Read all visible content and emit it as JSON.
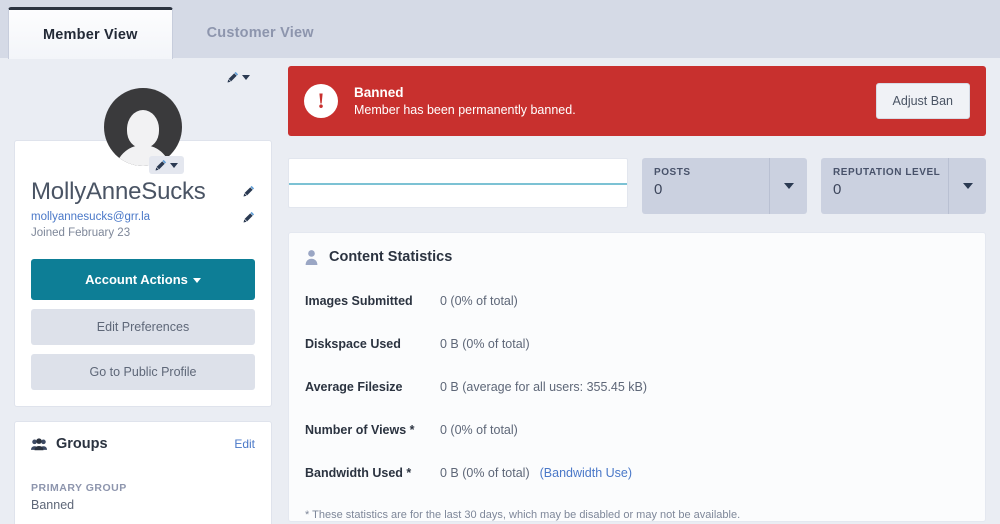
{
  "tabs": [
    {
      "label": "Member View",
      "active": true
    },
    {
      "label": "Customer View",
      "active": false
    }
  ],
  "sidebar": {
    "edit_icon": "pencil-caret-icon",
    "avatar_icon": "user-avatar-placeholder",
    "username": "MollyAnneSucks",
    "email": "mollyannesucks@grr.la",
    "joined": "Joined February 23",
    "buttons": {
      "account_actions": "Account Actions",
      "edit_preferences": "Edit Preferences",
      "go_to_public_profile": "Go to Public Profile"
    },
    "groups": {
      "icon": "users-group-icon",
      "title": "Groups",
      "edit_label": "Edit",
      "primary_label": "PRIMARY GROUP",
      "primary_value": "Banned"
    }
  },
  "banner": {
    "icon": "exclamation-circle-icon",
    "glyph": "!",
    "title": "Banned",
    "subtitle": "Member has been permanently banned.",
    "action_label": "Adjust Ban",
    "color": "#c8302e"
  },
  "strip": {
    "graph": {
      "name": "activity-graph",
      "line_color": "#7cc2d4"
    },
    "stats": [
      {
        "label": "POSTS",
        "value": "0"
      },
      {
        "label": "REPUTATION LEVEL",
        "value": "0"
      }
    ]
  },
  "content_statistics": {
    "icon": "person-icon",
    "title": "Content Statistics",
    "rows": [
      {
        "label": "Images Submitted",
        "value": "0 (0% of total)",
        "link": ""
      },
      {
        "label": "Diskspace Used",
        "value": "0 B (0% of total)",
        "link": ""
      },
      {
        "label": "Average Filesize",
        "value": "0 B (average for all users: 355.45 kB)",
        "link": ""
      },
      {
        "label": "Number of Views *",
        "value": "0 (0% of total)",
        "link": ""
      },
      {
        "label": "Bandwidth Used *",
        "value": "0 B (0% of total)",
        "link": "(Bandwidth Use)"
      }
    ],
    "footnote": "* These statistics are for the last 30 days, which may be disabled or may not be available."
  },
  "colors": {
    "page_bg": "#eaedf3",
    "tabbar_bg": "#d5dae6",
    "primary_button": "#0d7e96",
    "accent_link": "#4a78c8",
    "danger": "#c8302e"
  }
}
